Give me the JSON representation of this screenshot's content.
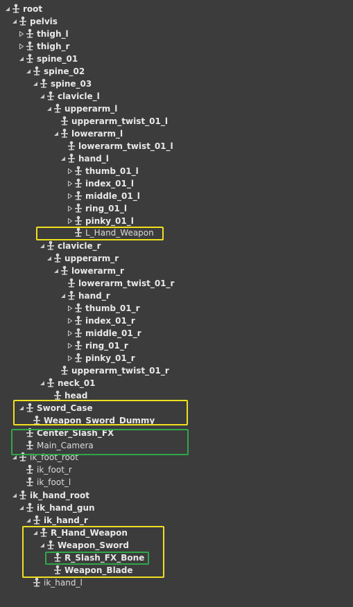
{
  "colors": {
    "background": "#3c3c3c",
    "text": "#e6e6e6",
    "highlight_yellow": "#f0e020",
    "highlight_green": "#2fa84a"
  },
  "tree": [
    {
      "label": "root",
      "depth": 0,
      "arrow": "open",
      "icon": "bone-icon",
      "style": "bold"
    },
    {
      "label": "pelvis",
      "depth": 1,
      "arrow": "open",
      "icon": "bone-icon",
      "style": "bold"
    },
    {
      "label": "thigh_l",
      "depth": 2,
      "arrow": "closed",
      "icon": "bone-icon",
      "style": "bold"
    },
    {
      "label": "thigh_r",
      "depth": 2,
      "arrow": "closed",
      "icon": "bone-icon",
      "style": "bold"
    },
    {
      "label": "spine_01",
      "depth": 2,
      "arrow": "open",
      "icon": "bone-icon",
      "style": "bold"
    },
    {
      "label": "spine_02",
      "depth": 3,
      "arrow": "open",
      "icon": "bone-icon",
      "style": "bold"
    },
    {
      "label": "spine_03",
      "depth": 4,
      "arrow": "open",
      "icon": "bone-icon",
      "style": "bold"
    },
    {
      "label": "clavicle_l",
      "depth": 5,
      "arrow": "open",
      "icon": "bone-icon",
      "style": "bold"
    },
    {
      "label": "upperarm_l",
      "depth": 6,
      "arrow": "open",
      "icon": "bone-icon",
      "style": "bold"
    },
    {
      "label": "upperarm_twist_01_l",
      "depth": 7,
      "arrow": "none",
      "icon": "bone-icon",
      "style": "bold"
    },
    {
      "label": "lowerarm_l",
      "depth": 7,
      "arrow": "open",
      "icon": "bone-icon",
      "style": "bold"
    },
    {
      "label": "lowerarm_twist_01_l",
      "depth": 8,
      "arrow": "none",
      "icon": "bone-icon",
      "style": "bold"
    },
    {
      "label": "hand_l",
      "depth": 8,
      "arrow": "open",
      "icon": "bone-icon",
      "style": "bold"
    },
    {
      "label": "thumb_01_l",
      "depth": 9,
      "arrow": "closed",
      "icon": "bone-icon",
      "style": "bold"
    },
    {
      "label": "index_01_l",
      "depth": 9,
      "arrow": "closed",
      "icon": "bone-icon",
      "style": "bold"
    },
    {
      "label": "middle_01_l",
      "depth": 9,
      "arrow": "closed",
      "icon": "bone-icon",
      "style": "bold"
    },
    {
      "label": "ring_01_l",
      "depth": 9,
      "arrow": "closed",
      "icon": "bone-icon",
      "style": "bold"
    },
    {
      "label": "pinky_01_l",
      "depth": 9,
      "arrow": "closed",
      "icon": "bone-icon",
      "style": "bold"
    },
    {
      "label": "L_Hand_Weapon",
      "depth": 9,
      "arrow": "none",
      "icon": "bone-icon",
      "style": "normal"
    },
    {
      "label": "clavicle_r",
      "depth": 5,
      "arrow": "open",
      "icon": "bone-icon",
      "style": "bold"
    },
    {
      "label": "upperarm_r",
      "depth": 6,
      "arrow": "open",
      "icon": "bone-icon",
      "style": "bold"
    },
    {
      "label": "lowerarm_r",
      "depth": 7,
      "arrow": "open",
      "icon": "bone-icon",
      "style": "bold"
    },
    {
      "label": "lowerarm_twist_01_r",
      "depth": 8,
      "arrow": "none",
      "icon": "bone-icon",
      "style": "bold"
    },
    {
      "label": "hand_r",
      "depth": 8,
      "arrow": "open",
      "icon": "bone-icon",
      "style": "bold"
    },
    {
      "label": "thumb_01_r",
      "depth": 9,
      "arrow": "closed",
      "icon": "bone-icon",
      "style": "bold"
    },
    {
      "label": "index_01_r",
      "depth": 9,
      "arrow": "closed",
      "icon": "bone-icon",
      "style": "bold"
    },
    {
      "label": "middle_01_r",
      "depth": 9,
      "arrow": "closed",
      "icon": "bone-icon",
      "style": "bold"
    },
    {
      "label": "ring_01_r",
      "depth": 9,
      "arrow": "closed",
      "icon": "bone-icon",
      "style": "bold"
    },
    {
      "label": "pinky_01_r",
      "depth": 9,
      "arrow": "closed",
      "icon": "bone-icon",
      "style": "bold"
    },
    {
      "label": "upperarm_twist_01_r",
      "depth": 7,
      "arrow": "none",
      "icon": "bone-icon",
      "style": "bold"
    },
    {
      "label": "neck_01",
      "depth": 5,
      "arrow": "open",
      "icon": "bone-icon",
      "style": "bold"
    },
    {
      "label": "head",
      "depth": 6,
      "arrow": "none",
      "icon": "bone-icon",
      "style": "bold"
    },
    {
      "label": "Sword_Case",
      "depth": 2,
      "arrow": "open",
      "icon": "bone-icon",
      "style": "bold"
    },
    {
      "label": "Weapon_Sword_Dummy",
      "depth": 3,
      "arrow": "none",
      "icon": "bone-icon",
      "style": "bold"
    },
    {
      "label": "Center_Slash_FX",
      "depth": 2,
      "arrow": "none",
      "icon": "bone-icon",
      "style": "bold"
    },
    {
      "label": "Main_Camera",
      "depth": 2,
      "arrow": "none",
      "icon": "bone-icon",
      "style": "normal"
    },
    {
      "label": "ik_foot_root",
      "depth": 1,
      "arrow": "open",
      "icon": "bone-icon",
      "style": "normal"
    },
    {
      "label": "ik_foot_r",
      "depth": 2,
      "arrow": "none",
      "icon": "bone-icon",
      "style": "normal"
    },
    {
      "label": "ik_foot_l",
      "depth": 2,
      "arrow": "none",
      "icon": "bone-icon",
      "style": "normal"
    },
    {
      "label": "ik_hand_root",
      "depth": 1,
      "arrow": "open",
      "icon": "bone-icon",
      "style": "bold"
    },
    {
      "label": "ik_hand_gun",
      "depth": 2,
      "arrow": "open",
      "icon": "bone-icon",
      "style": "bold"
    },
    {
      "label": "ik_hand_r",
      "depth": 3,
      "arrow": "open",
      "icon": "bone-icon",
      "style": "bold"
    },
    {
      "label": "R_Hand_Weapon",
      "depth": 4,
      "arrow": "open",
      "icon": "bone-icon",
      "style": "bold"
    },
    {
      "label": "Weapon_Sword",
      "depth": 5,
      "arrow": "open",
      "icon": "bone-icon",
      "style": "bold"
    },
    {
      "label": "R_Slash_FX_Bone",
      "depth": 6,
      "arrow": "none",
      "icon": "bone-icon",
      "style": "bold"
    },
    {
      "label": "Weapon_Blade",
      "depth": 6,
      "arrow": "none",
      "icon": "bone-icon",
      "style": "bold"
    },
    {
      "label": "ik_hand_l",
      "depth": 3,
      "arrow": "none",
      "icon": "bone-icon",
      "style": "normal"
    }
  ]
}
